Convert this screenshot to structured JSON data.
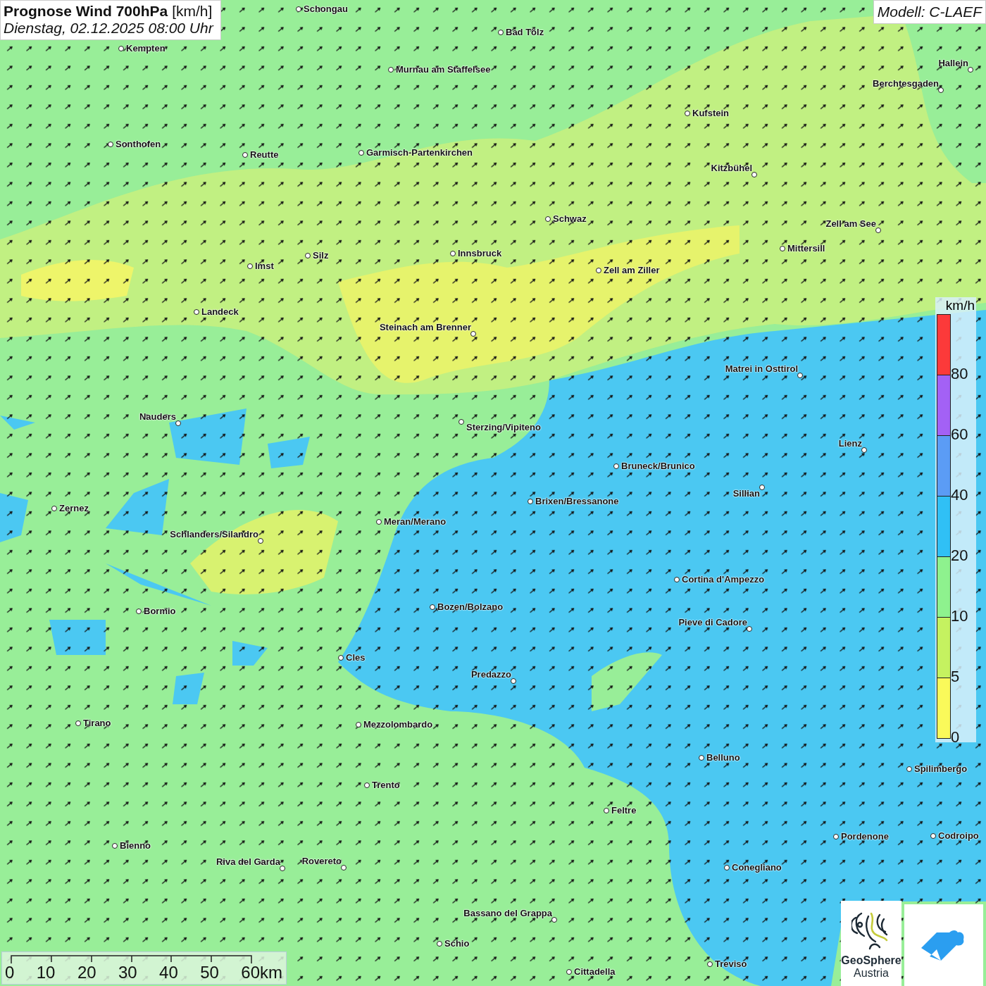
{
  "header": {
    "title": "Prognose Wind 700hPa",
    "unit": "[km/h]",
    "datetime": "Dienstag, 02.12.2025 08:00 Uhr"
  },
  "model": "Modell: C-LAEF",
  "cities": [
    {
      "name": "Schongau"
    },
    {
      "name": "Bad Tölz"
    },
    {
      "name": "Kempten"
    },
    {
      "name": "Murnau am Staffelsee"
    },
    {
      "name": "Hallein"
    },
    {
      "name": "Berchtesgaden"
    },
    {
      "name": "Kufstein"
    },
    {
      "name": "Sonthofen"
    },
    {
      "name": "Reutte"
    },
    {
      "name": "Garmisch-Partenkirchen"
    },
    {
      "name": "Kitzbühel"
    },
    {
      "name": "Schwaz"
    },
    {
      "name": "Zell am See"
    },
    {
      "name": "Mittersill"
    },
    {
      "name": "Innsbruck"
    },
    {
      "name": "Silz"
    },
    {
      "name": "Imst"
    },
    {
      "name": "Zell am Ziller"
    },
    {
      "name": "Landeck"
    },
    {
      "name": "Steinach am Brenner"
    },
    {
      "name": "Matrei in Osttirol"
    },
    {
      "name": "Nauders"
    },
    {
      "name": "Sterzing/Vipiteno"
    },
    {
      "name": "Lienz"
    },
    {
      "name": "Bruneck/Brunico"
    },
    {
      "name": "Sillian"
    },
    {
      "name": "Brixen/Bressanone"
    },
    {
      "name": "Zernez"
    },
    {
      "name": "Meran/Merano"
    },
    {
      "name": "Schlanders/Silandro"
    },
    {
      "name": "Cortina d'Ampezzo"
    },
    {
      "name": "Bozen/Bolzano"
    },
    {
      "name": "Bormio"
    },
    {
      "name": "Pieve di Cadore"
    },
    {
      "name": "Cles"
    },
    {
      "name": "Predazzo"
    },
    {
      "name": "Tirano"
    },
    {
      "name": "Mezzolombardo"
    },
    {
      "name": "Belluno"
    },
    {
      "name": "Spilimbergo"
    },
    {
      "name": "Trento"
    },
    {
      "name": "Feltre"
    },
    {
      "name": "Pordenone"
    },
    {
      "name": "Codroipo"
    },
    {
      "name": "Bienno"
    },
    {
      "name": "Riva del Garda"
    },
    {
      "name": "Rovereto"
    },
    {
      "name": "Conegliano"
    },
    {
      "name": "Bassano del Grappa"
    },
    {
      "name": "Schio"
    },
    {
      "name": "Treviso"
    },
    {
      "name": "Cittadella"
    }
  ],
  "legend": {
    "unit": "km/h",
    "classes": [
      {
        "label": "80",
        "color": "#fc3a3a"
      },
      {
        "label": "60",
        "color": "#a361f5"
      },
      {
        "label": "40",
        "color": "#5b9cf5"
      },
      {
        "label": "20",
        "color": "#30c0f5"
      },
      {
        "label": "10",
        "color": "#8ef28e"
      },
      {
        "label": "5",
        "color": "#c5f260"
      },
      {
        "label": "0",
        "color": "#fafa5a"
      }
    ]
  },
  "scale_bar": {
    "ticks": [
      "0",
      "10",
      "20",
      "30",
      "40",
      "50",
      "60km"
    ]
  },
  "logo": {
    "name": "GeoSphere",
    "country": "Austria"
  }
}
